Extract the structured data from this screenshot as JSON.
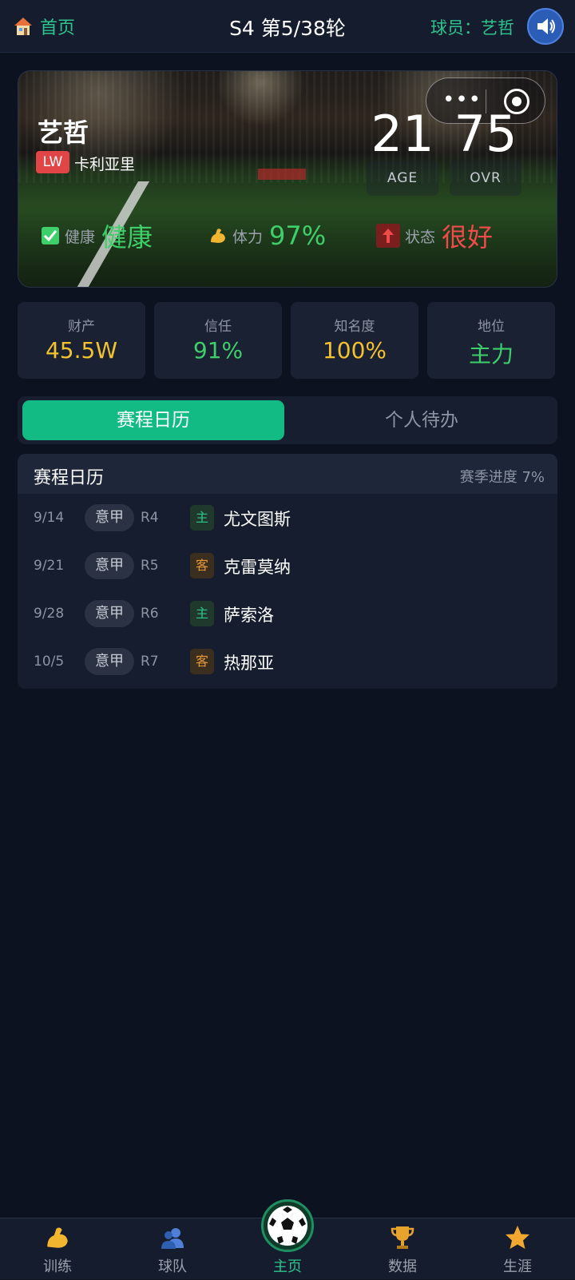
{
  "header": {
    "home_label": "首页",
    "round_title": "S4 第5/38轮",
    "player_tag": "球员：艺哲",
    "icons": {
      "home": "house-icon",
      "sound": "speaker-icon"
    }
  },
  "hero": {
    "name": "艺哲",
    "position": "LW",
    "club": "卡利亚里",
    "age_value": "21",
    "age_label": "AGE",
    "ovr_value": "75",
    "ovr_label": "OVR",
    "capsule": {
      "more": "•••",
      "icons": [
        "more-icon",
        "target-icon"
      ]
    },
    "conditions": [
      {
        "icon": "check-icon",
        "key": "健康",
        "value": "健康",
        "color": "#3ecf6a"
      },
      {
        "icon": "flexed-arm-icon",
        "key": "体力",
        "value": "97%",
        "color": "#3ecf6a"
      },
      {
        "icon": "arrow-up-icon",
        "key": "状态",
        "value": "很好",
        "color": "#f04a4a"
      }
    ]
  },
  "metrics": [
    {
      "key": "财产",
      "value": "45.5W",
      "color": "#f2c230"
    },
    {
      "key": "信任",
      "value": "91%",
      "color": "#3ecf6a"
    },
    {
      "key": "知名度",
      "value": "100%",
      "color": "#f2c230"
    },
    {
      "key": "地位",
      "value": "主力",
      "color": "#3ecf6a"
    }
  ],
  "tabs": {
    "active": "赛程日历",
    "inactive": "个人待办"
  },
  "calendar": {
    "title": "赛程日历",
    "progress": "赛季进度 7%",
    "rows": [
      {
        "date": "9/14",
        "league": "意甲",
        "round": "R4",
        "venue": "主",
        "opponent": "尤文图斯"
      },
      {
        "date": "9/21",
        "league": "意甲",
        "round": "R5",
        "venue": "客",
        "opponent": "克雷莫纳"
      },
      {
        "date": "9/28",
        "league": "意甲",
        "round": "R6",
        "venue": "主",
        "opponent": "萨索洛"
      },
      {
        "date": "10/5",
        "league": "意甲",
        "round": "R7",
        "venue": "客",
        "opponent": "热那亚"
      }
    ]
  },
  "bottom_nav": [
    {
      "label": "训练",
      "icon": "flexed-arm-icon"
    },
    {
      "label": "球队",
      "icon": "team-icon"
    },
    {
      "label": "主页",
      "icon": "soccer-ball-icon"
    },
    {
      "label": "数据",
      "icon": "trophy-icon"
    },
    {
      "label": "生涯",
      "icon": "star-icon"
    }
  ]
}
